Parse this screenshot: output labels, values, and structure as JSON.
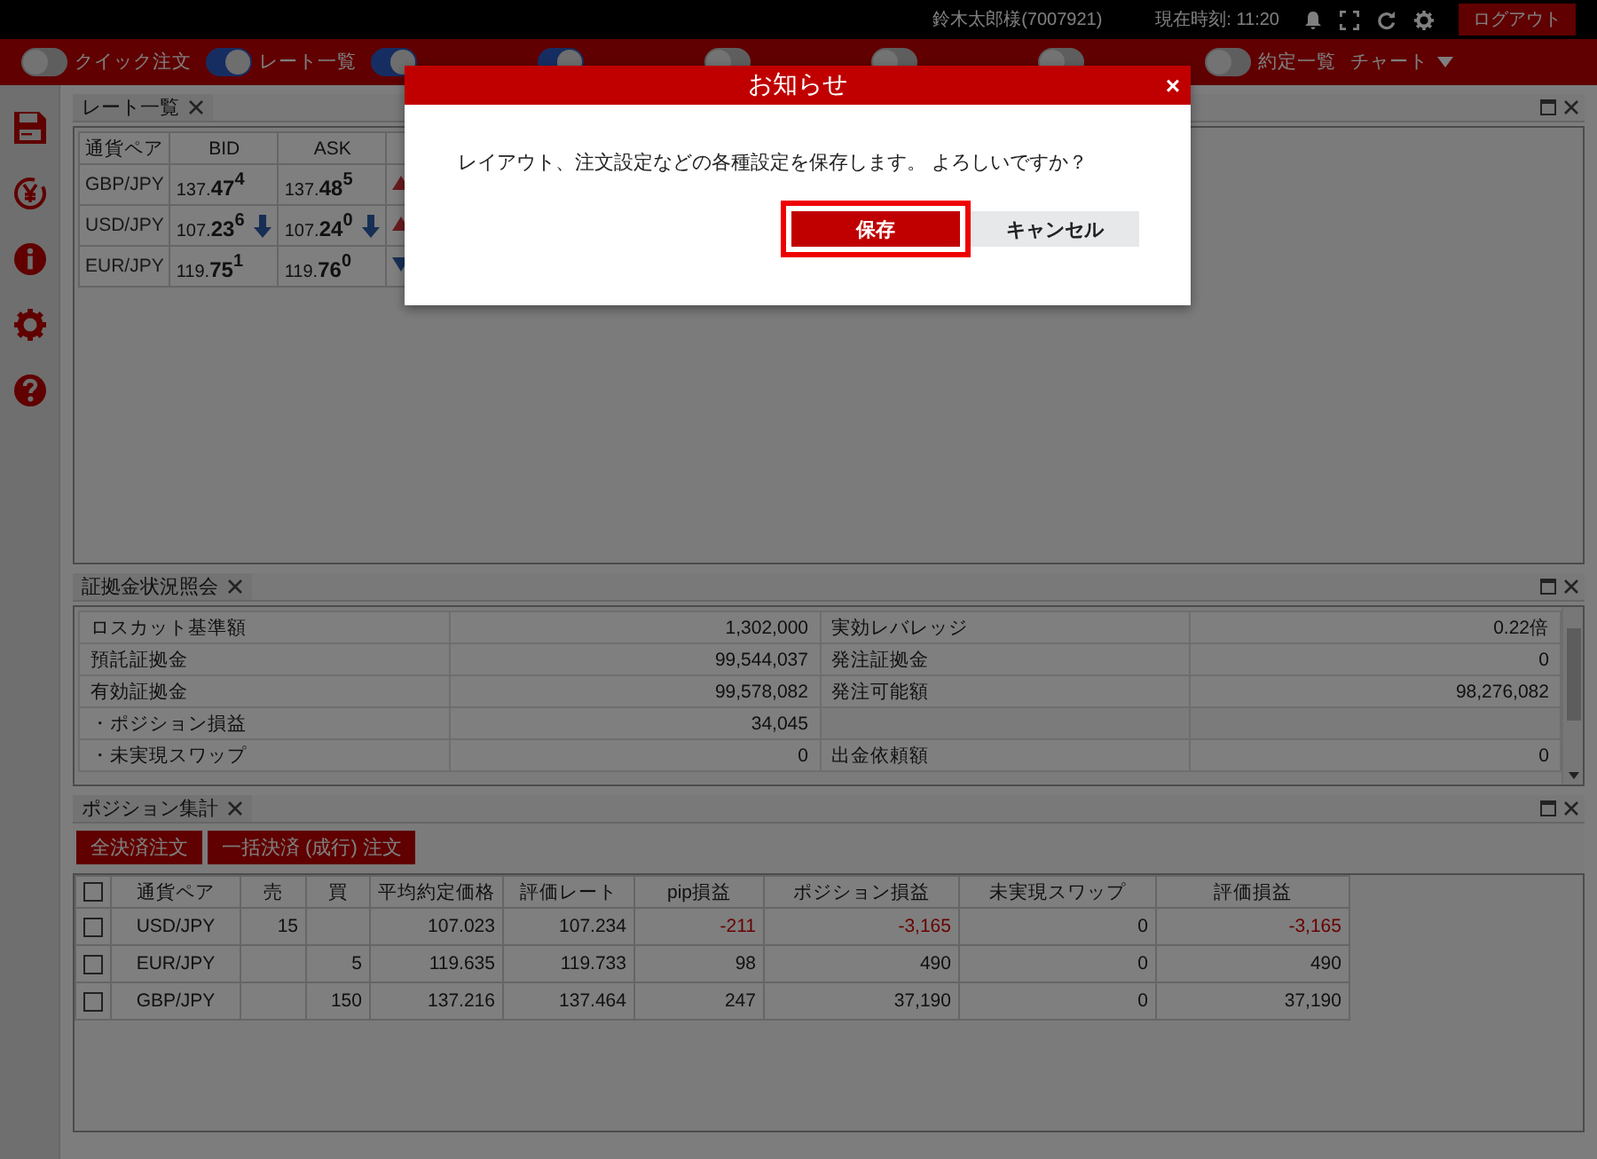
{
  "top_bar": {
    "user": "鈴木太郎様(7007921)",
    "clock": "現在時刻: 11:20",
    "logout": "ログアウト"
  },
  "nav": {
    "toggles": [
      {
        "label": "クイック注文",
        "on": false
      },
      {
        "label": "レート一覧",
        "on": true
      },
      {
        "on": true
      },
      {
        "on": true
      },
      {
        "on": false
      },
      {
        "on": false
      },
      {
        "on": false
      },
      {
        "label": "約定一覧",
        "on": false
      }
    ],
    "chart_menu": "チャート"
  },
  "rate_panel": {
    "title": "レート一覧",
    "columns": [
      "通貨ペア",
      "BID",
      "ASK"
    ],
    "rows": [
      {
        "pair": "GBP/JPY",
        "bid": {
          "lead": "137.",
          "big": "47",
          "pip": "4",
          "falling": false
        },
        "ask": {
          "lead": "137.",
          "big": "48",
          "pip": "5",
          "falling": false
        },
        "rising": true
      },
      {
        "pair": "USD/JPY",
        "bid": {
          "lead": "107.",
          "big": "23",
          "pip": "6",
          "falling": true
        },
        "ask": {
          "lead": "107.",
          "big": "24",
          "pip": "0",
          "falling": true
        },
        "rising": true
      },
      {
        "pair": "EUR/JPY",
        "bid": {
          "lead": "119.",
          "big": "75",
          "pip": "1",
          "falling": false
        },
        "ask": {
          "lead": "119.",
          "big": "76",
          "pip": "0",
          "falling": false
        },
        "rising": false
      }
    ]
  },
  "margin_panel": {
    "title": "証拠金状況照会",
    "rows": [
      {
        "label": "ロスカット基準額",
        "value": "1,302,000",
        "label_2": "実効レバレッジ",
        "value_2": "0.22倍"
      },
      {
        "label": "預託証拠金",
        "value": "99,544,037",
        "label_2": "発注証拠金",
        "value_2": "0"
      },
      {
        "label": "有効証拠金",
        "value": "99,578,082",
        "label_2": "発注可能額",
        "value_2": "98,276,082"
      },
      {
        "label": "・ポジション損益",
        "value": "34,045"
      },
      {
        "label": "・未実現スワップ",
        "value": "0",
        "label_2": "出金依頼額",
        "value_2": "0"
      }
    ]
  },
  "position_panel": {
    "title": "ポジション集計",
    "buttons": [
      "全決済注文",
      "一括決済 (成行) 注文"
    ],
    "columns": [
      "通貨ペア",
      "売",
      "買",
      "平均約定価格",
      "評価レート",
      "pip損益",
      "ポジション損益",
      "未実現スワップ",
      "評価損益"
    ],
    "all_checked": false,
    "rows": [
      {
        "checked": false,
        "loss": true,
        "pair": "USD/JPY",
        "sell": "15",
        "avg": "107.023",
        "rate": "107.234",
        "pip": "-211",
        "pl": "-3,165",
        "swap": "0",
        "total": "-3,165"
      },
      {
        "checked": false,
        "loss": false,
        "pair": "EUR/JPY",
        "buy": "5",
        "avg": "119.635",
        "rate": "119.733",
        "pip": "98",
        "pl": "490",
        "swap": "0",
        "total": "490"
      },
      {
        "checked": false,
        "loss": false,
        "pair": "GBP/JPY",
        "buy": "150",
        "avg": "137.216",
        "rate": "137.464",
        "pip": "247",
        "pl": "37,190",
        "swap": "0",
        "total": "37,190"
      }
    ]
  },
  "dialog": {
    "title": "お知らせ",
    "close": "×",
    "message": "レイアウト、注文設定などの各種設定を保存します。 よろしいですか？",
    "buttons": [
      {
        "label": "保存",
        "kind": "primary",
        "focused": true
      },
      {
        "label": "キャンセル",
        "kind": "secondary",
        "focused": false
      }
    ]
  }
}
